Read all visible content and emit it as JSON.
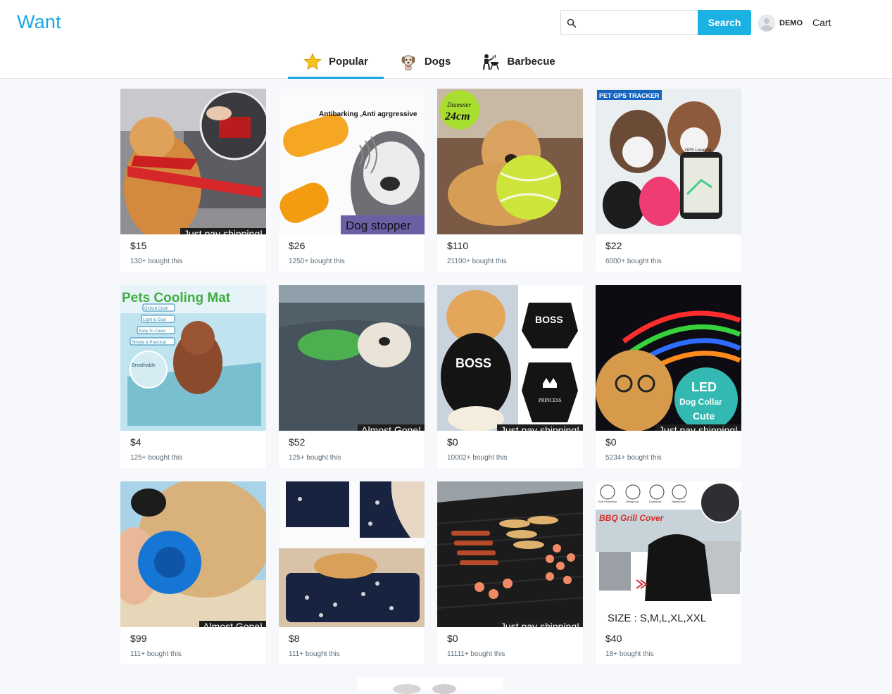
{
  "app": {
    "logo": "Want"
  },
  "search": {
    "placeholder": "",
    "button_label": "Search"
  },
  "user": {
    "name": "DEMO"
  },
  "cart": {
    "label": "Cart"
  },
  "tabs": [
    {
      "label": "Popular",
      "icon": "star-icon",
      "active": true
    },
    {
      "label": "Dogs",
      "icon": "dog-icon",
      "active": false
    },
    {
      "label": "Barbecue",
      "icon": "barbecue-icon",
      "active": false
    }
  ],
  "products": [
    {
      "price": "$15",
      "sold": "130+ bought this",
      "banner": "Just pay shipping!",
      "image": "dog seat belt"
    },
    {
      "price": "$26",
      "sold": "1250+ bought this",
      "banner": "",
      "overlay": [
        "Antibarking ,Anti agrgressive",
        "Dog stopper"
      ],
      "image": "anti-barking device"
    },
    {
      "price": "$110",
      "sold": "21100+ bought this",
      "banner": "",
      "overlay": [
        "Diameter",
        "24cm"
      ],
      "image": "giant tennis ball"
    },
    {
      "price": "$22",
      "sold": "6000+ bought this",
      "banner": "",
      "overlay": [
        "PET GPS TRACKER",
        "GPS Locating"
      ],
      "image": "pet gps tracker"
    },
    {
      "price": "$4",
      "sold": "125+ bought this",
      "banner": "",
      "overlay": [
        "Pets Cooling Mat",
        "Oxford Cloth",
        "Light & Cool",
        "Easy To Clean",
        "Simple & Practical",
        "Breathable"
      ],
      "image": "pets cooling mat"
    },
    {
      "price": "$52",
      "sold": "125+ bought this",
      "banner": "Almost Gone!",
      "image": "dog life jacket"
    },
    {
      "price": "$0",
      "sold": "10002+ bought this",
      "banner": "Just pay shipping!",
      "overlay": [
        "BOSS",
        "BOSS",
        "PRINCESS"
      ],
      "image": "dog shirt"
    },
    {
      "price": "$0",
      "sold": "5234+ bought this",
      "banner": "Just pay shipping!",
      "overlay": [
        "LED",
        "Dog Collar",
        "Cute"
      ],
      "image": "led dog collar"
    },
    {
      "price": "$99",
      "sold": "111+ bought this",
      "banner": "Almost Gone!",
      "image": "dog chew ball"
    },
    {
      "price": "$8",
      "sold": "111+ bought this",
      "banner": "",
      "image": "dog bed mat"
    },
    {
      "price": "$0",
      "sold": "11111+ bought this",
      "banner": "Just pay shipping!",
      "image": "grill mat"
    },
    {
      "price": "$40",
      "sold": "18+ bought this",
      "banner": "",
      "overlay": [
        "Sun Protection",
        "Windproof",
        "Dustproof",
        "Waterproof",
        "BBQ Grill Cover",
        "SIZE : S,M,L,XL,XXL"
      ],
      "image": "bbq grill cover"
    }
  ],
  "colors": {
    "accent": "#1aa7e4",
    "search_button": "#1cb1e3",
    "banner_bg": "#1e1e1e"
  }
}
